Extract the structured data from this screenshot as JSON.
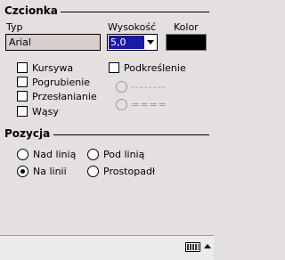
{
  "font_section": {
    "title": "Czcionka",
    "type_label": "Typ",
    "type_value": "Arial",
    "size_label": "Wysokość",
    "size_value": "5,0",
    "color_label": "Kolor",
    "color_value": "#000000"
  },
  "styles": {
    "italic": {
      "label": "Kursywa",
      "checked": false
    },
    "bold": {
      "label": "Pogrubienie",
      "checked": false
    },
    "strikeout": {
      "label": "Przesłanianie",
      "checked": false
    },
    "whiskers": {
      "label": "Wąsy",
      "checked": false
    },
    "underline": {
      "label": "Podkreślenie",
      "checked": false
    },
    "underline_single": "--------",
    "underline_double": "===="
  },
  "position_section": {
    "title": "Pozycja",
    "options": {
      "above": "Nad linią",
      "below": "Pod linią",
      "on": "Na linii",
      "perpendicular": "Prostopadł"
    },
    "selected": "on"
  },
  "taskbar": {
    "keyboard_icon": "keyboard-icon",
    "arrow_icon": "up-arrow-icon"
  }
}
